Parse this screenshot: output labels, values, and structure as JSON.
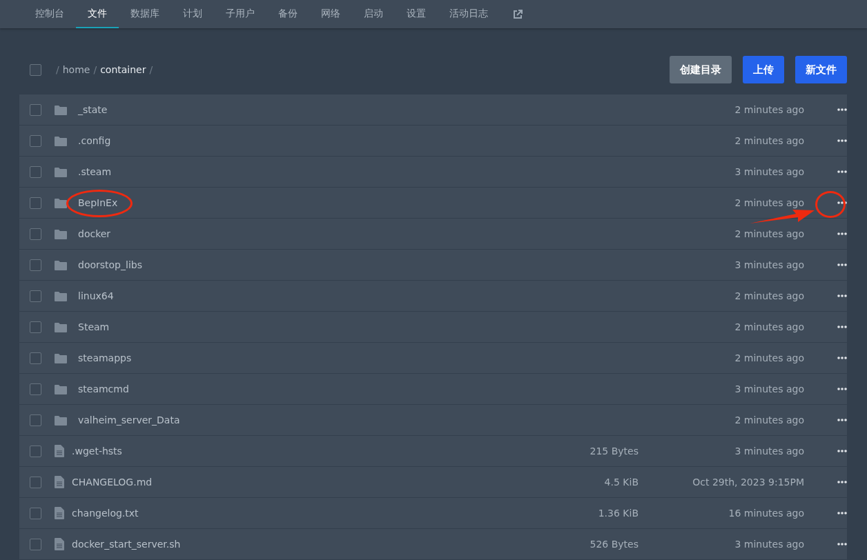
{
  "nav": {
    "tabs": [
      {
        "label": "控制台",
        "selected": false
      },
      {
        "label": "文件",
        "selected": true
      },
      {
        "label": "数据库",
        "selected": false
      },
      {
        "label": "计划",
        "selected": false
      },
      {
        "label": "子用户",
        "selected": false
      },
      {
        "label": "备份",
        "selected": false
      },
      {
        "label": "网络",
        "selected": false
      },
      {
        "label": "启动",
        "selected": false
      },
      {
        "label": "设置",
        "selected": false
      },
      {
        "label": "活动日志",
        "selected": false
      }
    ]
  },
  "breadcrumb": {
    "checked": false,
    "separator": "/",
    "segments": [
      {
        "label": "home",
        "current": false
      },
      {
        "label": "container",
        "current": true
      }
    ]
  },
  "buttons": [
    {
      "label": "创建目录",
      "kind": "secondary"
    },
    {
      "label": "上传",
      "kind": "primary"
    },
    {
      "label": "新文件",
      "kind": "primary"
    }
  ],
  "files": [
    {
      "kind": "folder",
      "name": "_state",
      "modified": "2 minutes ago",
      "checked": false,
      "annotated": false
    },
    {
      "kind": "folder",
      "name": ".config",
      "modified": "2 minutes ago",
      "checked": false,
      "annotated": false
    },
    {
      "kind": "folder",
      "name": ".steam",
      "modified": "3 minutes ago",
      "checked": false,
      "annotated": false
    },
    {
      "kind": "folder",
      "name": "BepInEx",
      "modified": "2 minutes ago",
      "checked": false,
      "annotated": true
    },
    {
      "kind": "folder",
      "name": "docker",
      "modified": "2 minutes ago",
      "checked": false,
      "annotated": false
    },
    {
      "kind": "folder",
      "name": "doorstop_libs",
      "modified": "3 minutes ago",
      "checked": false,
      "annotated": false
    },
    {
      "kind": "folder",
      "name": "linux64",
      "modified": "2 minutes ago",
      "checked": false,
      "annotated": false
    },
    {
      "kind": "folder",
      "name": "Steam",
      "modified": "2 minutes ago",
      "checked": false,
      "annotated": false
    },
    {
      "kind": "folder",
      "name": "steamapps",
      "modified": "2 minutes ago",
      "checked": false,
      "annotated": false
    },
    {
      "kind": "folder",
      "name": "steamcmd",
      "modified": "3 minutes ago",
      "checked": false,
      "annotated": false
    },
    {
      "kind": "folder",
      "name": "valheim_server_Data",
      "modified": "2 minutes ago",
      "checked": false,
      "annotated": false
    },
    {
      "kind": "file",
      "name": ".wget-hsts",
      "size": "215 Bytes",
      "modified": "3 minutes ago",
      "checked": false,
      "annotated": false
    },
    {
      "kind": "file",
      "name": "CHANGELOG.md",
      "size": "4.5 KiB",
      "modified": "Oct 29th, 2023 9:15PM",
      "checked": false,
      "annotated": false
    },
    {
      "kind": "file",
      "name": "changelog.txt",
      "size": "1.36 KiB",
      "modified": "16 minutes ago",
      "checked": false,
      "annotated": false
    },
    {
      "kind": "file",
      "name": "docker_start_server.sh",
      "size": "526 Bytes",
      "modified": "3 minutes ago",
      "checked": false,
      "annotated": false
    }
  ]
}
